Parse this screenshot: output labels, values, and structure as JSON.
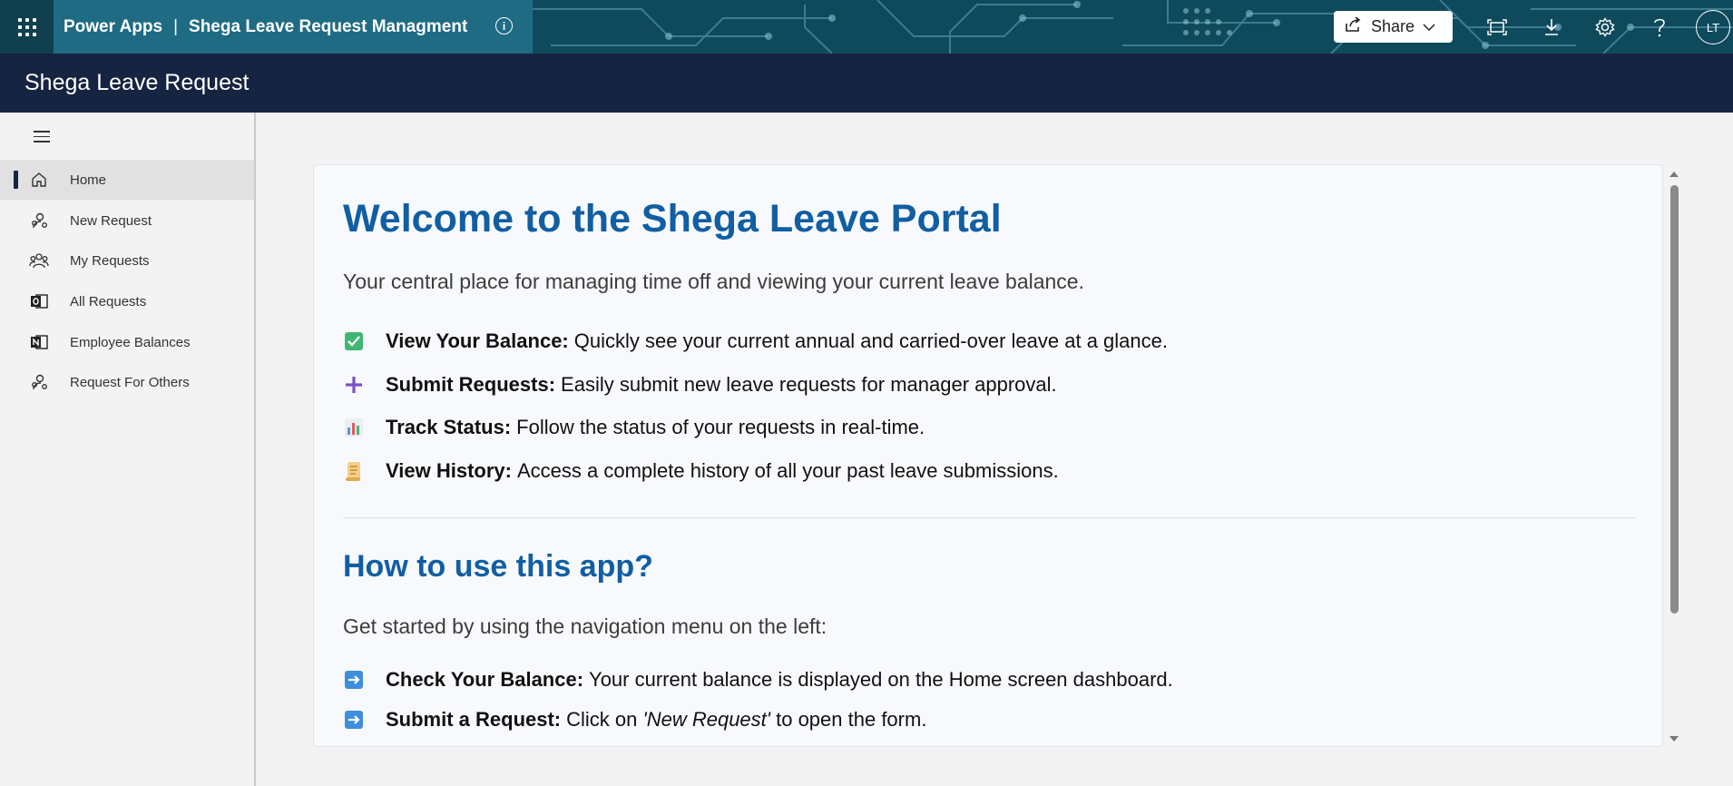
{
  "topbar": {
    "brand": "Power Apps",
    "separator": "|",
    "app_name": "Shega Leave Request Managment",
    "info_glyph": "i",
    "share_label": "Share",
    "user_initials": "LT",
    "icons": [
      "waffle-icon",
      "info-icon",
      "share-icon",
      "chevron-down-icon",
      "fullscreen-icon",
      "download-icon",
      "gear-icon",
      "help-icon"
    ]
  },
  "header": {
    "title": "Shega Leave Request"
  },
  "sidebar": {
    "items": [
      {
        "label": "Home",
        "icon": "home-icon",
        "active": true
      },
      {
        "label": "New Request",
        "icon": "person-add-icon",
        "active": false
      },
      {
        "label": "My Requests",
        "icon": "people-icon",
        "active": false
      },
      {
        "label": "All Requests",
        "icon": "outlook-icon",
        "active": false
      },
      {
        "label": "Employee Balances",
        "icon": "onenote-icon",
        "active": false
      },
      {
        "label": "Request For Others",
        "icon": "person-add-icon",
        "active": false
      }
    ]
  },
  "main": {
    "title": "Welcome to the Shega Leave Portal",
    "lead": "Your central place for managing time off and viewing your current leave balance.",
    "features": [
      {
        "icon": "check-box-icon",
        "bold": "View Your Balance:",
        "text": "Quickly see your current annual and carried-over leave at a glance."
      },
      {
        "icon": "plus-icon",
        "bold": "Submit Requests:",
        "text": "Easily submit new leave requests for manager approval."
      },
      {
        "icon": "bar-chart-icon",
        "bold": "Track Status:",
        "text": "Follow the status of your requests in real-time."
      },
      {
        "icon": "scroll-icon",
        "bold": "View History:",
        "text": "Access a complete history of all your past leave submissions."
      }
    ],
    "how_title": "How to use this app?",
    "how_lead": "Get started by using the navigation menu on the left:",
    "steps": [
      {
        "icon": "arrow-right-icon",
        "bold": "Check Your Balance:",
        "text": "Your current balance is displayed on the Home screen dashboard."
      },
      {
        "icon": "arrow-right-icon",
        "bold": "Submit a Request:",
        "text_before": "Click on ",
        "italic": "'New Request'",
        "text_after": " to open the form."
      }
    ]
  },
  "colors": {
    "topbar": "#1f6b84",
    "header": "#152440",
    "heading": "#115ea3",
    "sidebar": "#f3f3f3",
    "active_item": "#e1e1e1"
  }
}
